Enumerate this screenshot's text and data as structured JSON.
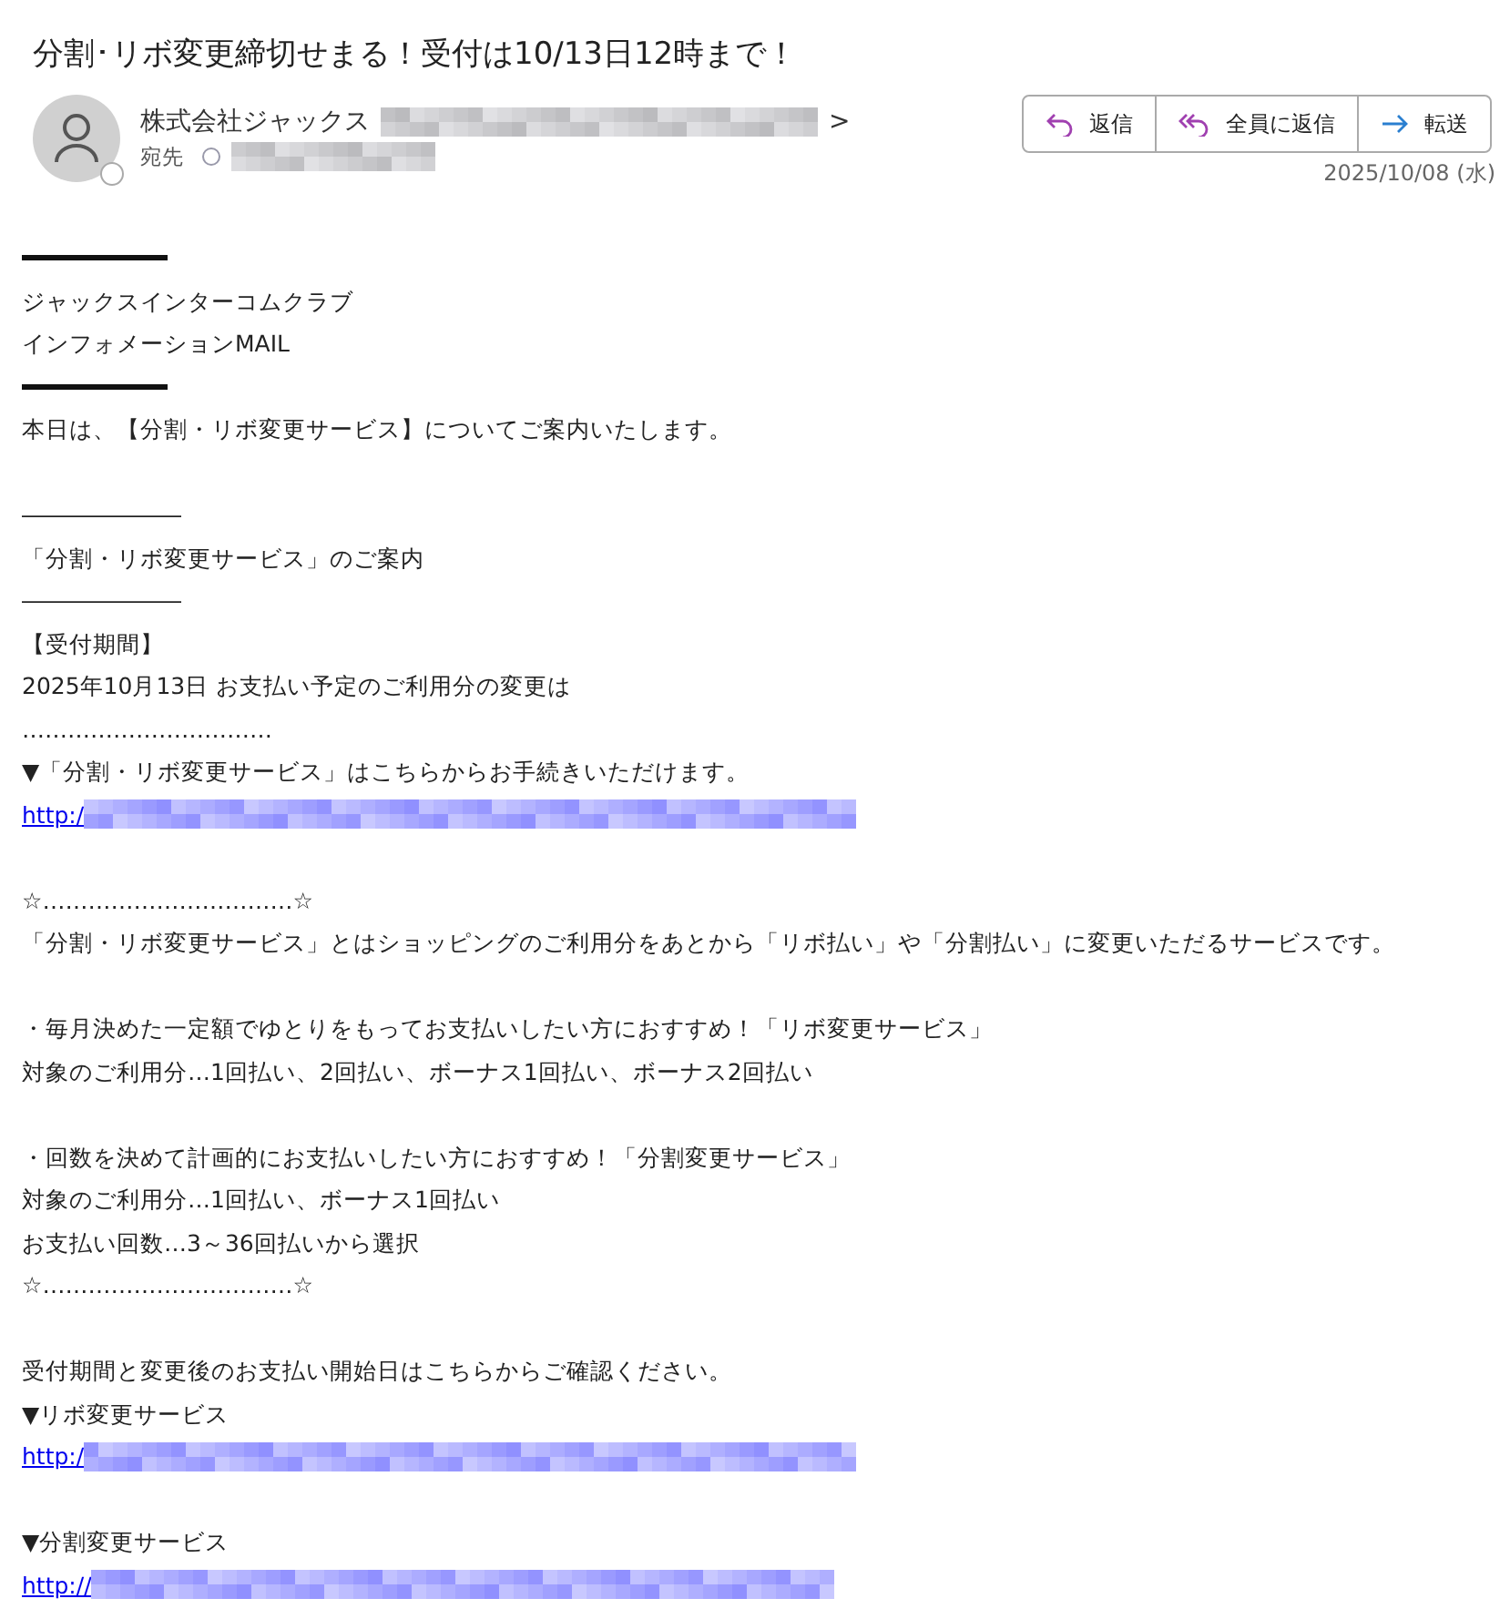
{
  "subject": "分割･リボ変更締切せまる！受付は10/13日12時まで！",
  "sender": {
    "name": "株式会社ジャックス",
    "address_end": ">",
    "to_label": "宛先"
  },
  "actions": [
    {
      "kind": "reply",
      "label": "返信"
    },
    {
      "kind": "reply_all",
      "label": "全員に返信"
    },
    {
      "kind": "forward",
      "label": "転送"
    }
  ],
  "date": "2025/10/08 (水)",
  "body": [
    {
      "kind": "rule"
    },
    {
      "kind": "text",
      "text": "ジャックスインターコムクラブ"
    },
    {
      "kind": "text",
      "text": "インフォメーションMAIL"
    },
    {
      "kind": "rule"
    },
    {
      "kind": "text",
      "text": "本日は、【分割・リボ変更サービス】についてご案内いたします。"
    },
    {
      "kind": "blank"
    },
    {
      "kind": "text",
      "text": "―――――――"
    },
    {
      "kind": "text",
      "text": "「分割・リボ変更サービス」のご案内"
    },
    {
      "kind": "text",
      "text": "―――――――"
    },
    {
      "kind": "text",
      "text": "【受付期間】"
    },
    {
      "kind": "text",
      "text": "2025年10月13日 お支払い予定のご利用分の変更は"
    },
    {
      "kind": "text",
      "text": "……………………………"
    },
    {
      "kind": "text",
      "text": "▼「分割・リボ変更サービス」はこちらからお手続きいただけます。"
    },
    {
      "kind": "link",
      "text": "http:/"
    },
    {
      "kind": "blank"
    },
    {
      "kind": "text",
      "text": "☆……………………………☆"
    },
    {
      "kind": "text",
      "text": "「分割・リボ変更サービス」とはショッピングのご利用分をあとから「リボ払い」や「分割払い」に変更いただるサービスです。"
    },
    {
      "kind": "blank"
    },
    {
      "kind": "text",
      "text": "・毎月決めた一定額でゆとりをもってお支払いしたい方におすすめ！「リボ変更サービス」"
    },
    {
      "kind": "text",
      "text": "対象のご利用分…1回払い、2回払い、ボーナス1回払い、ボーナス2回払い"
    },
    {
      "kind": "blank"
    },
    {
      "kind": "text",
      "text": "・回数を決めて計画的にお支払いしたい方におすすめ！「分割変更サービス」"
    },
    {
      "kind": "text",
      "text": "対象のご利用分…1回払い、ボーナス1回払い"
    },
    {
      "kind": "text",
      "text": "お支払い回数…3～36回払いから選択"
    },
    {
      "kind": "text",
      "text": "☆……………………………☆"
    },
    {
      "kind": "blank"
    },
    {
      "kind": "text",
      "text": "受付期間と変更後のお支払い開始日はこちらからご確認ください。"
    },
    {
      "kind": "text",
      "text": "▼リボ変更サービス"
    },
    {
      "kind": "link",
      "text": "http:/"
    },
    {
      "kind": "blank"
    },
    {
      "kind": "text",
      "text": "▼分割変更サービス"
    },
    {
      "kind": "link",
      "text": "http://"
    }
  ]
}
